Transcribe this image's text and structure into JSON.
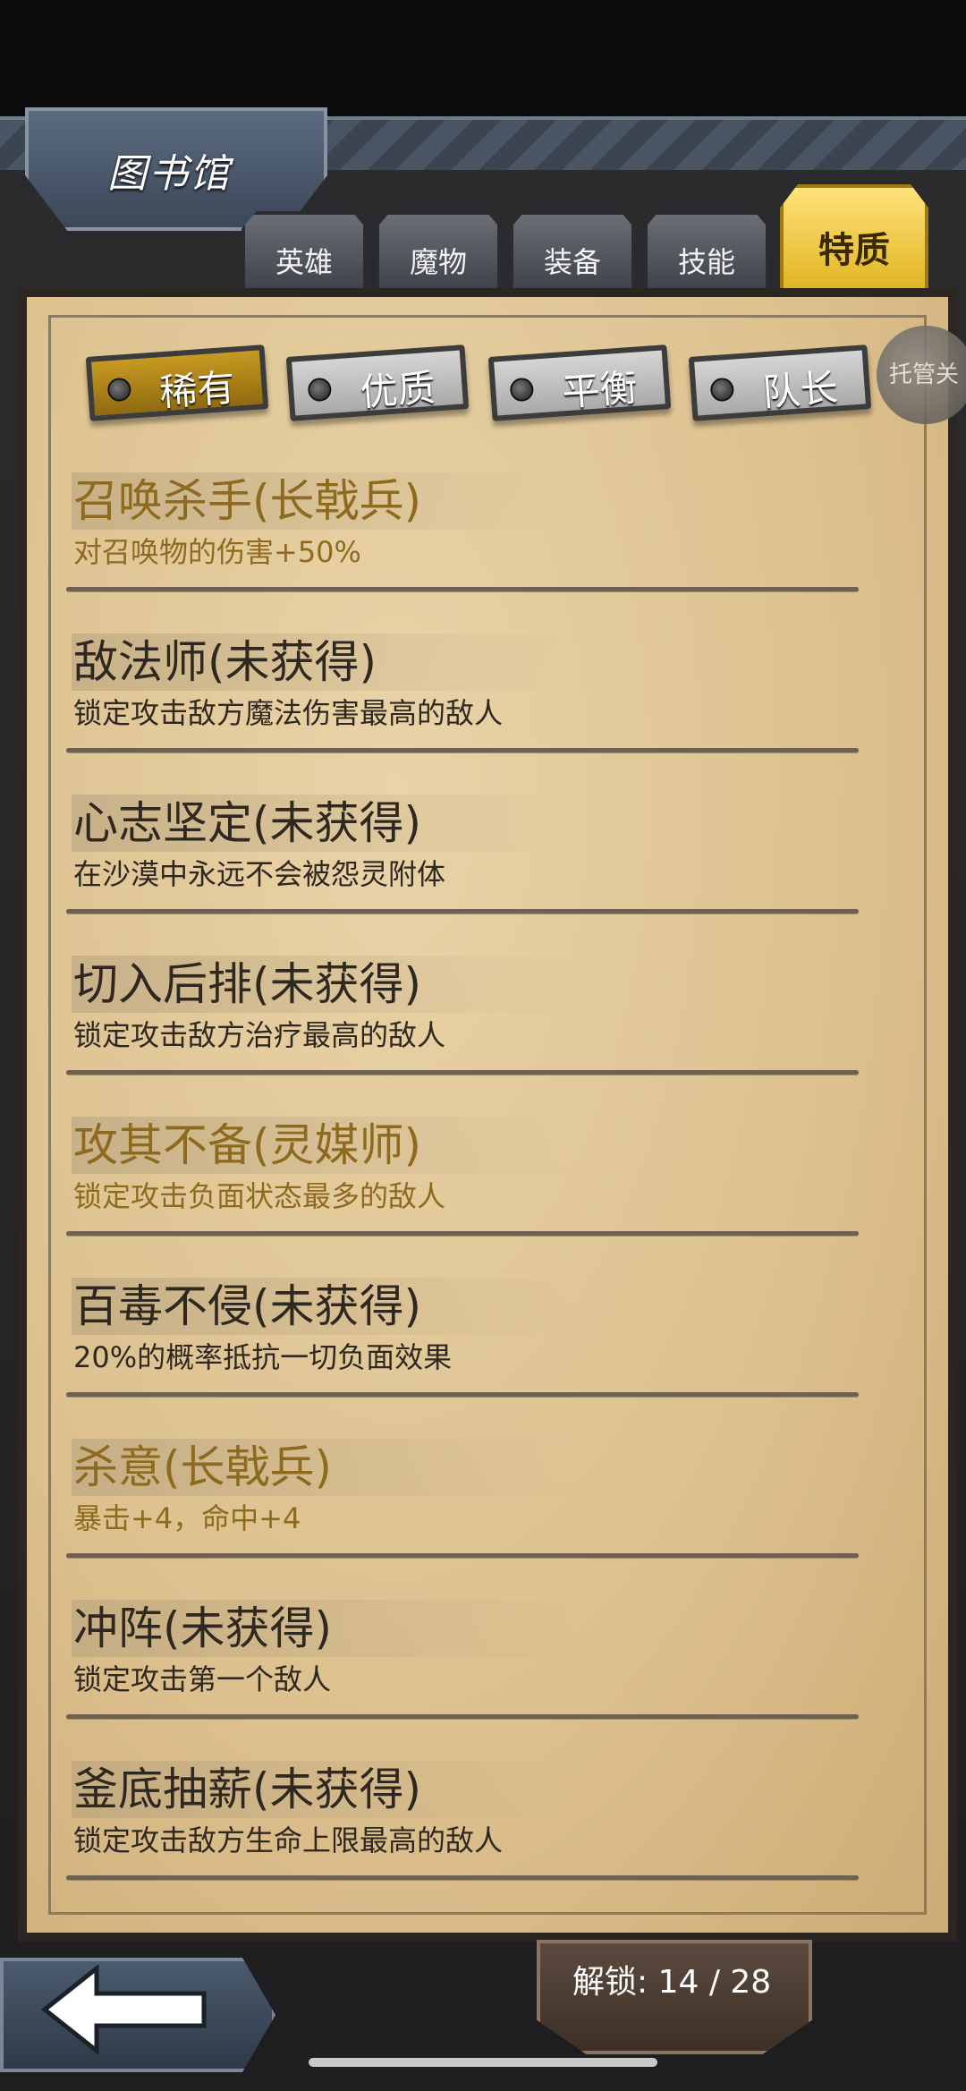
{
  "header": {
    "title": "图书馆"
  },
  "tabs": [
    {
      "label": "英雄",
      "active": false
    },
    {
      "label": "魔物",
      "active": false
    },
    {
      "label": "装备",
      "active": false
    },
    {
      "label": "技能",
      "active": false
    },
    {
      "label": "特质",
      "active": true
    }
  ],
  "subtabs": [
    {
      "label": "稀有",
      "active": true
    },
    {
      "label": "优质",
      "active": false
    },
    {
      "label": "平衡",
      "active": false
    },
    {
      "label": "队长",
      "active": false
    }
  ],
  "side_button": {
    "label": "托管关"
  },
  "traits": [
    {
      "name": "召唤杀手(长戟兵)",
      "desc": "对召唤物的伤害+50%",
      "owned": true
    },
    {
      "name": "敌法师(未获得)",
      "desc": "锁定攻击敌方魔法伤害最高的敌人",
      "owned": false
    },
    {
      "name": "心志坚定(未获得)",
      "desc": "在沙漠中永远不会被怨灵附体",
      "owned": false
    },
    {
      "name": "切入后排(未获得)",
      "desc": "锁定攻击敌方治疗最高的敌人",
      "owned": false
    },
    {
      "name": "攻其不备(灵媒师)",
      "desc": "锁定攻击负面状态最多的敌人",
      "owned": true
    },
    {
      "name": "百毒不侵(未获得)",
      "desc": "20%的概率抵抗一切负面效果",
      "owned": false
    },
    {
      "name": "杀意(长戟兵)",
      "desc": "暴击+4，命中+4",
      "owned": true
    },
    {
      "name": "冲阵(未获得)",
      "desc": "锁定攻击第一个敌人",
      "owned": false
    },
    {
      "name": "釜底抽薪(未获得)",
      "desc": "锁定攻击敌方生命上限最高的敌人",
      "owned": false
    }
  ],
  "footer": {
    "unlock_text": "解锁: 14 / 28"
  },
  "icons": {
    "back": "back-arrow-icon"
  },
  "colors": {
    "owned_text": "#8d6a1e",
    "locked_text": "#2e2820",
    "active_tab": "#e0b320"
  }
}
